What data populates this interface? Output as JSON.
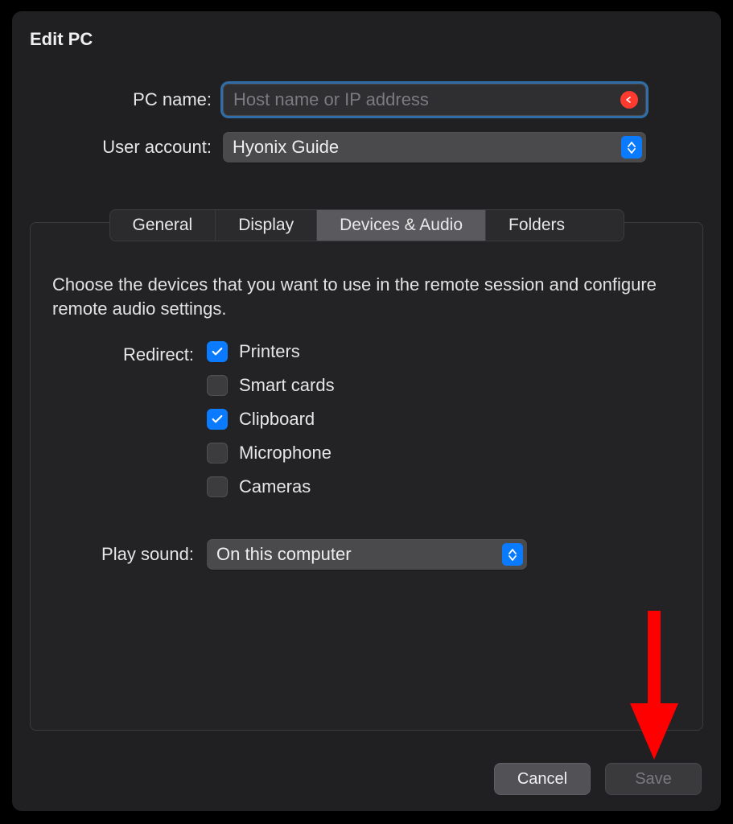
{
  "title": "Edit PC",
  "labels": {
    "pc_name": "PC name:",
    "user_account": "User account:",
    "redirect": "Redirect:",
    "play_sound": "Play sound:"
  },
  "pc_name": {
    "value": "",
    "placeholder": "Host name or IP address",
    "has_error": true
  },
  "user_account": {
    "value": "Hyonix Guide"
  },
  "tabs": [
    {
      "label": "General",
      "selected": false
    },
    {
      "label": "Display",
      "selected": false
    },
    {
      "label": "Devices & Audio",
      "selected": true
    },
    {
      "label": "Folders",
      "selected": false
    }
  ],
  "description": "Choose the devices that you want to use in the remote session and configure remote audio settings.",
  "redirect": [
    {
      "label": "Printers",
      "checked": true
    },
    {
      "label": "Smart cards",
      "checked": false
    },
    {
      "label": "Clipboard",
      "checked": true
    },
    {
      "label": "Microphone",
      "checked": false
    },
    {
      "label": "Cameras",
      "checked": false
    }
  ],
  "play_sound": {
    "value": "On this computer"
  },
  "buttons": {
    "cancel": "Cancel",
    "save": "Save"
  },
  "colors": {
    "accent": "#0a7bff",
    "error": "#ff3b30",
    "annotation_arrow": "#ff0000"
  }
}
